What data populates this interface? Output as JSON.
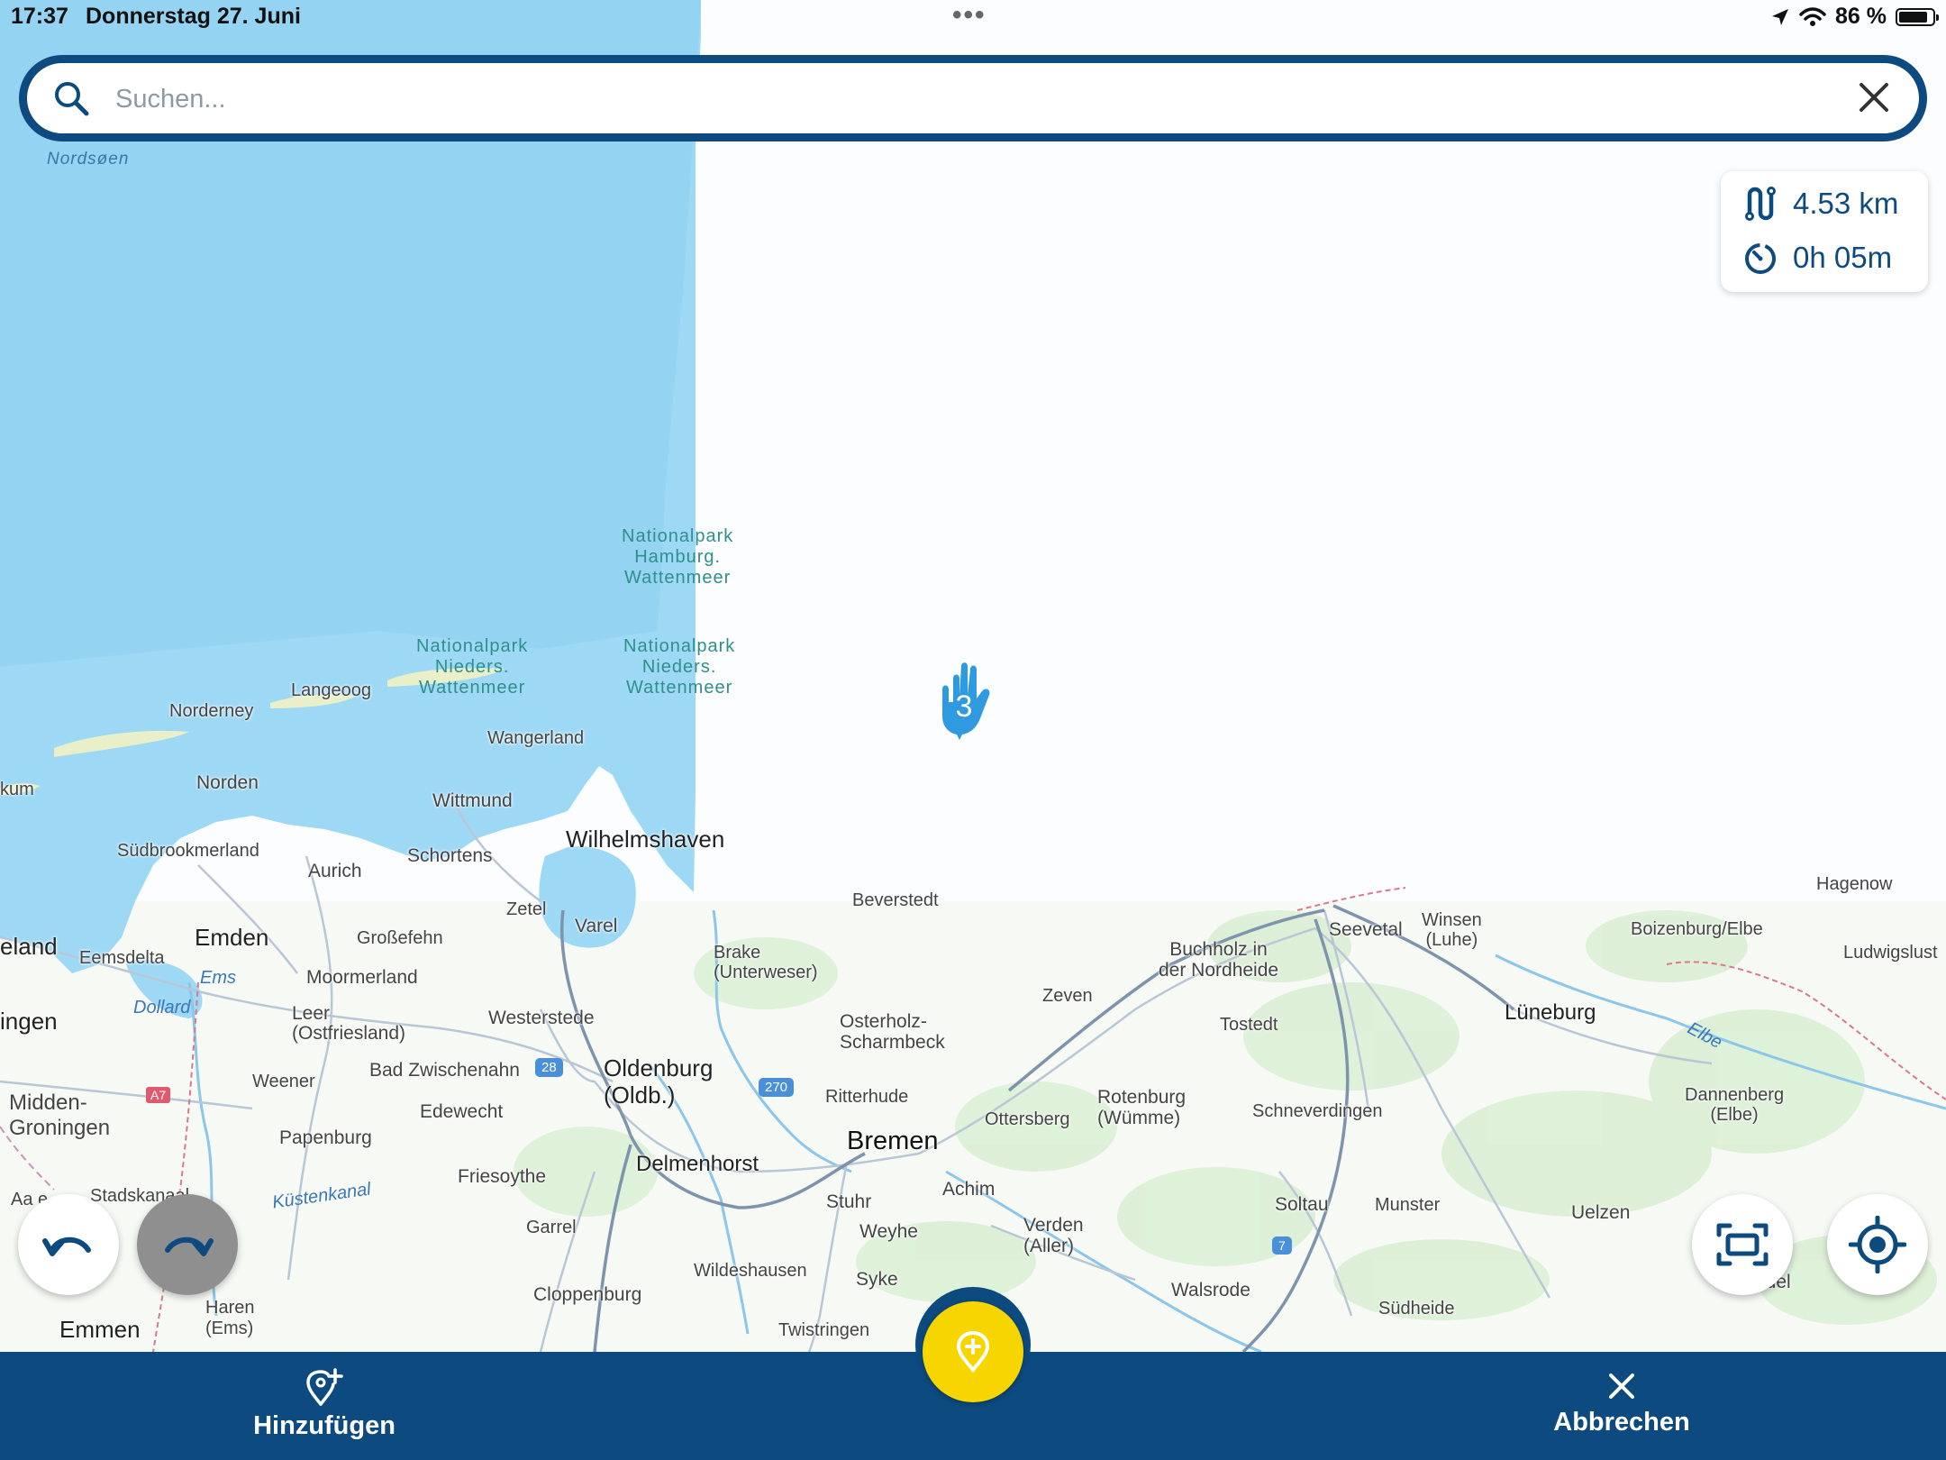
{
  "status_bar": {
    "time": "17:37",
    "date": "Donnerstag 27. Juni",
    "battery": "86 %",
    "battery_level": 0.86
  },
  "search": {
    "placeholder": "Suchen..."
  },
  "route_summary": {
    "distance": "4.53 km",
    "duration": "0h 05m"
  },
  "hand_marker": {
    "number": "3"
  },
  "map_labels": {
    "nordsoen": "Nordsøen",
    "np_hamburg": "Nationalpark\nHamburg.\nWattenmeer",
    "np_nieders_1": "Nationalpark\nNieders.\nWattenmeer",
    "np_nieders_2": "Nationalpark\nNieders.\nWattenmeer",
    "langeoog": "Langeoog",
    "norderney": "Norderney",
    "wangerland": "Wangerland",
    "kum": "kum",
    "norden": "Norden",
    "wittmund": "Wittmund",
    "wilhelmshaven": "Wilhelmshaven",
    "suedbrookmerland": "Südbrookmerland",
    "aurich": "Aurich",
    "schortens": "Schortens",
    "zetel": "Zetel",
    "varel": "Varel",
    "eland": "eland",
    "emden": "Emden",
    "eemsdelta": "Eemsdelta",
    "grossefehn": "Großefehn",
    "ems": "Ems",
    "moormerland": "Moormerland",
    "dollard": "Dollard",
    "ingen": "ingen",
    "leer": "Leer\n(Ostfriesland)",
    "westerstede": "Westerstede",
    "bad_zwischenahn": "Bad Zwischenahn",
    "oldenburg": "Oldenburg\n(Oldb.)",
    "weener": "Weener",
    "midden_groningen": "Midden-\nGroningen",
    "edewecht": "Edewecht",
    "papenburg": "Papenburg",
    "friesoythe": "Friesoythe",
    "kuestenkanal": "Küstenkanal",
    "stadskanaal": "Stadskanaal",
    "aa": "Aa e",
    "garrel": "Garrel",
    "haren": "Haren\n(Ems)",
    "emmen": "Emmen",
    "cloppenburg": "Cloppenburg",
    "wildeshausen": "Wildeshausen",
    "delmenhorst": "Delmenhorst",
    "bremen": "Bremen",
    "stuhr": "Stuhr",
    "weyhe": "Weyhe",
    "syke": "Syke",
    "twistringen": "Twistringen",
    "achim": "Achim",
    "beverstedt": "Beverstedt",
    "brake": "Brake\n(Unterweser)",
    "osterholz": "Osterholz-\nScharmbeck",
    "ritterhude": "Ritterhude",
    "zeven": "Zeven",
    "ottersberg": "Ottersberg",
    "rotenburg": "Rotenburg\n(Wümme)",
    "verden": "Verden\n(Aller)",
    "walsrode": "Walsrode",
    "soltau": "Soltau",
    "munster": "Munster",
    "suedheide": "Südheide",
    "uelzen": "Uelzen",
    "schneverdingen": "Schneverdingen",
    "tostedt": "Tostedt",
    "buchholz": "Buchholz in\nder Nordheide",
    "seevetal": "Seevetal",
    "winsen": "Winsen\n(Luhe)",
    "lueneburg": "Lüneburg",
    "elbe": "Elbe",
    "boizenburg": "Boizenburg/Elbe",
    "hagenow": "Hagenow",
    "ludwigslust": "Ludwigslust",
    "dannenberg": "Dannenberg\n(Elbe)",
    "edel": "edel",
    "a7_left": "A7",
    "a28": "28",
    "a270": "270",
    "a7_right": "7"
  },
  "bottom_bar": {
    "add_label": "Hinzufügen",
    "cancel_label": "Abbrechen"
  },
  "colors": {
    "primary": "#0d4a7f",
    "fab": "#f7d600",
    "water": "#9dd8f5",
    "land": "#fbfdff"
  }
}
